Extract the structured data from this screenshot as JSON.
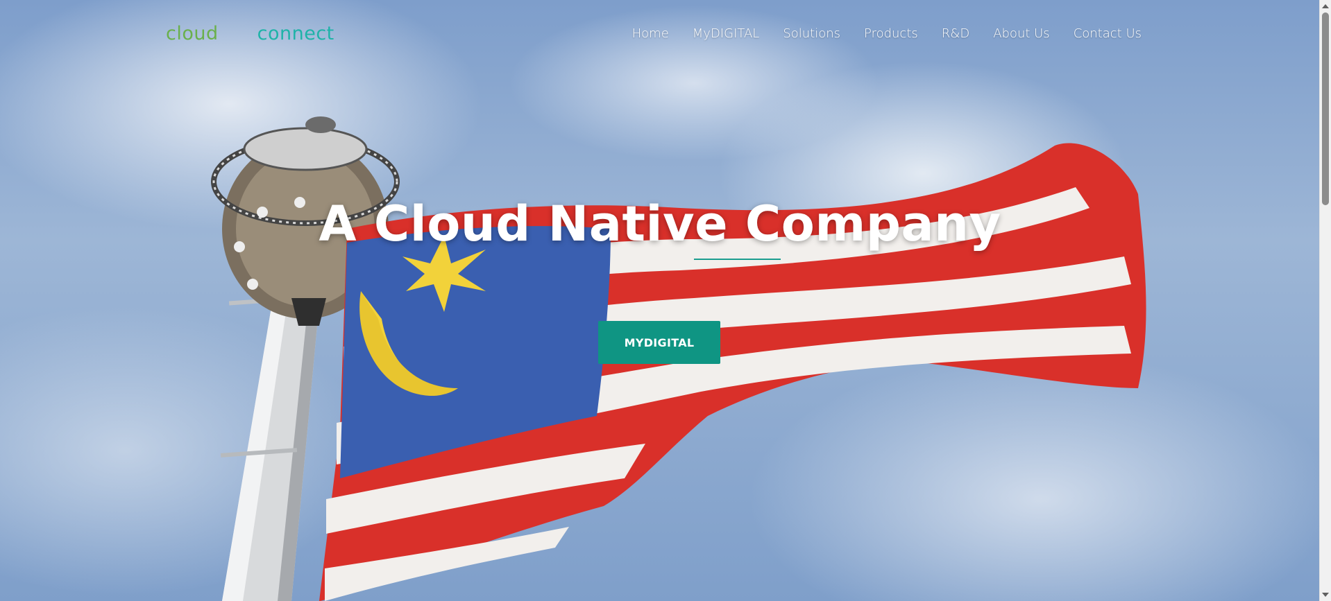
{
  "logo": {
    "part1": "cloud",
    "part2": "connect"
  },
  "nav": {
    "items": [
      {
        "label": "Home"
      },
      {
        "label": "MyDIGITAL"
      },
      {
        "label": "Solutions"
      },
      {
        "label": "Products"
      },
      {
        "label": "R&D"
      },
      {
        "label": "About Us"
      },
      {
        "label": "Contact Us"
      }
    ]
  },
  "hero": {
    "headline": "A Cloud Native Company",
    "cta_label": "MYDIGITAL",
    "image_icon": "malaysian-flag-on-tower-photo"
  },
  "colors": {
    "logo_green": "#6ab04c",
    "logo_teal": "#1fb3a8",
    "accent": "#0f9583"
  }
}
